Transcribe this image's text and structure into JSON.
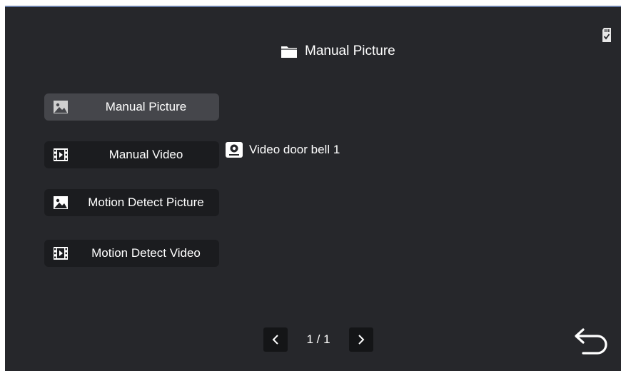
{
  "header": {
    "title": "Manual Picture",
    "icon": "folder-icon"
  },
  "status": {
    "sd_icon": "sd-card-check-icon"
  },
  "menu": [
    {
      "label": "Manual Picture",
      "icon": "picture-icon",
      "active": true
    },
    {
      "label": "Manual Video",
      "icon": "film-icon",
      "active": false
    },
    {
      "label": "Motion Detect Picture",
      "icon": "picture-icon",
      "active": false
    },
    {
      "label": "Motion Detect Video",
      "icon": "film-icon",
      "active": false
    }
  ],
  "device": {
    "name": "Video door bell 1",
    "icon": "doorbell-camera-icon"
  },
  "pagination": {
    "text": "1 / 1",
    "prev_icon": "chevron-left-icon",
    "next_icon": "chevron-right-icon"
  },
  "navigation": {
    "back_icon": "back-arrow-icon"
  },
  "colors": {
    "background": "#26272b",
    "button": "#1b1c1f",
    "button_active": "#45464b",
    "text": "#ffffff"
  }
}
